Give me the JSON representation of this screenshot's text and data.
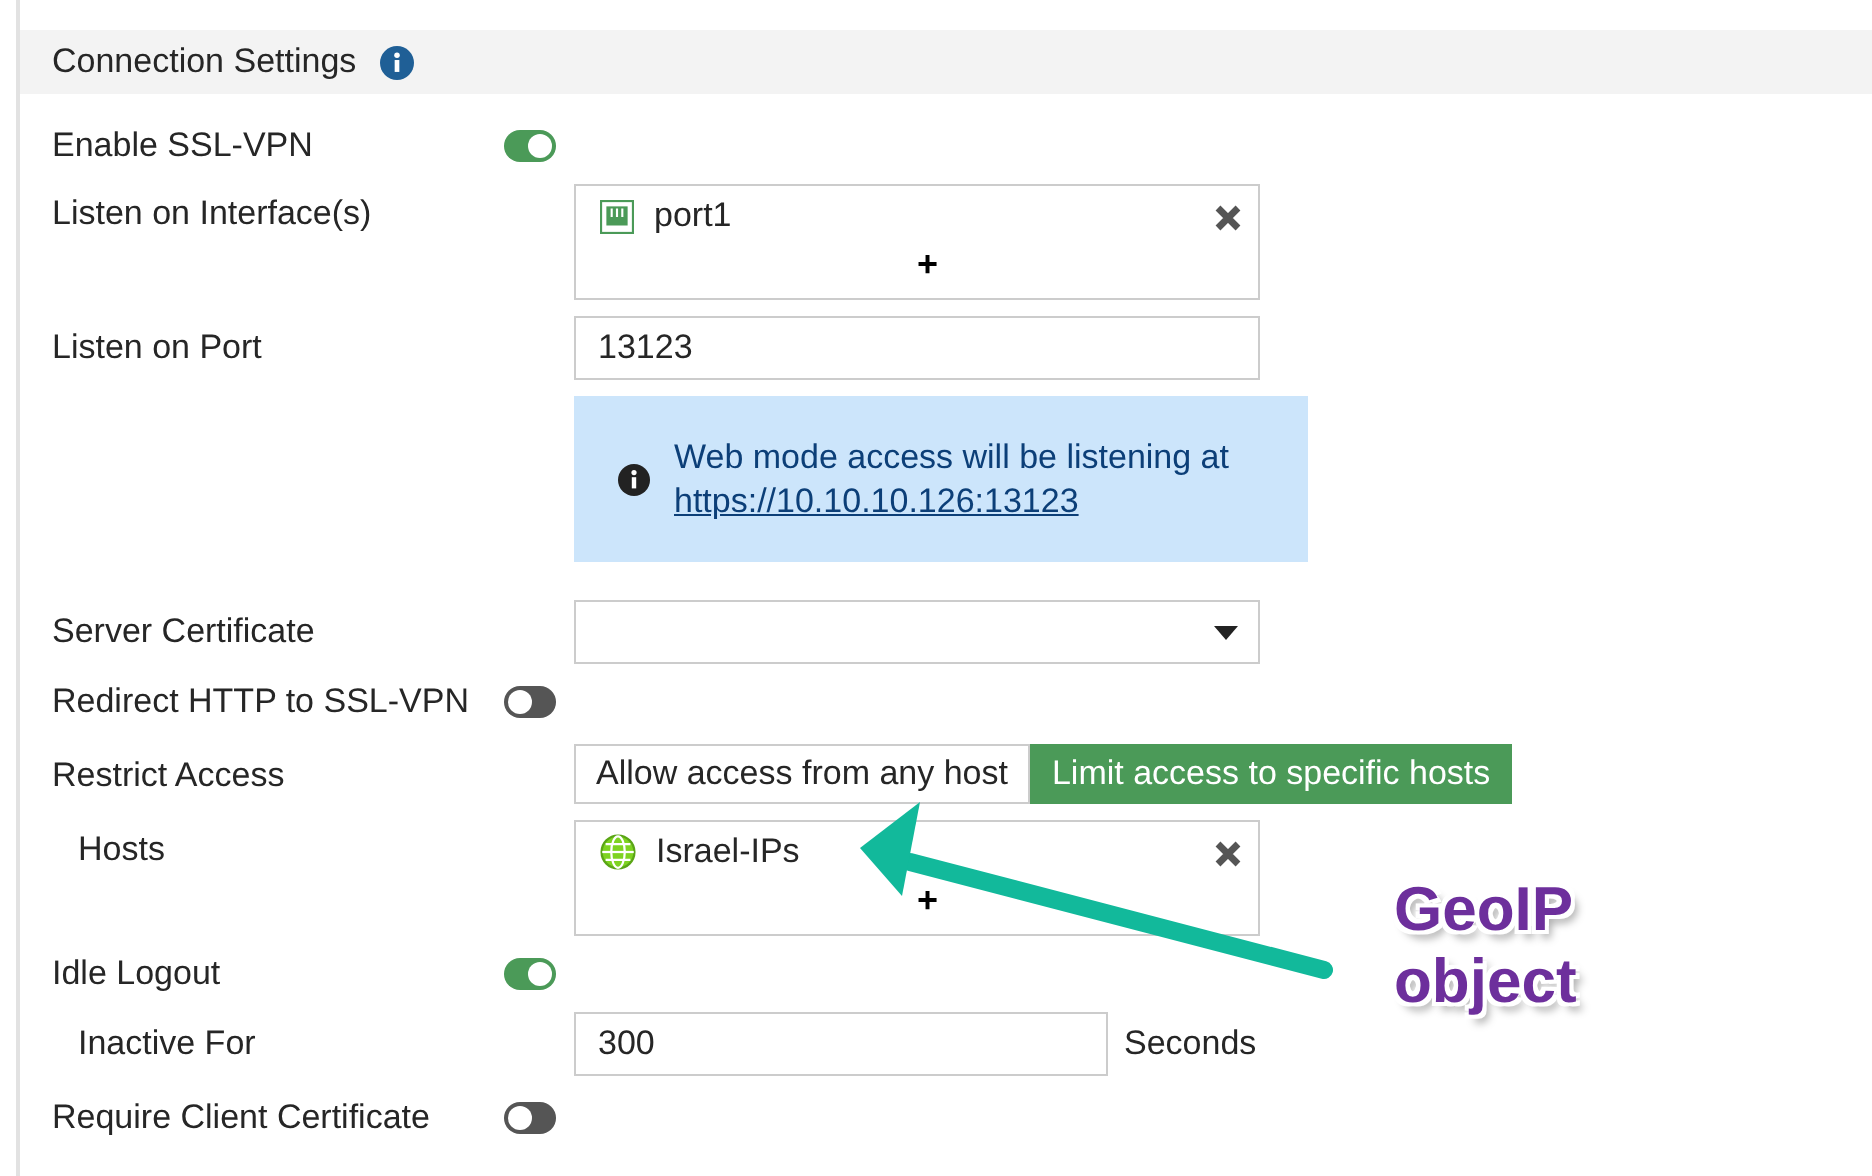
{
  "section": {
    "title": "Connection Settings"
  },
  "rows": [
    {
      "kind": "toggle",
      "label": "Enable SSL-VPN",
      "on": true
    },
    {
      "kind": "multiselect",
      "label": "Listen on Interface(s)",
      "items": [
        {
          "text": "port1",
          "kind": "interface"
        }
      ],
      "add": "+"
    },
    {
      "kind": "input",
      "label": "Listen on Port",
      "value": "13123"
    },
    {
      "kind": "info",
      "text": "Web mode access will be listening at",
      "link": "https://10.10.10.126:13123"
    },
    {
      "kind": "select",
      "label": "Server Certificate"
    },
    {
      "kind": "toggle",
      "label": "Redirect HTTP to SSL-VPN",
      "on": false
    },
    {
      "kind": "segmented",
      "label": "Restrict Access",
      "options": [
        {
          "text": "Allow access from any host",
          "selected": false
        },
        {
          "text": "Limit access to specific hosts",
          "selected": true
        }
      ],
      "children": [
        {
          "kind": "multiselect",
          "label": "Hosts",
          "items": [
            {
              "text": "Israel-IPs",
              "kind": "geo"
            }
          ],
          "add": "+"
        }
      ]
    },
    {
      "kind": "toggle",
      "label": "Idle Logout",
      "on": true,
      "children": [
        {
          "kind": "input",
          "label": "Inactive For",
          "value": "300",
          "suffix": "Seconds"
        }
      ]
    },
    {
      "kind": "toggle",
      "label": "Require Client Certificate",
      "on": false
    }
  ],
  "annotation": {
    "text": "GeoIP object"
  }
}
